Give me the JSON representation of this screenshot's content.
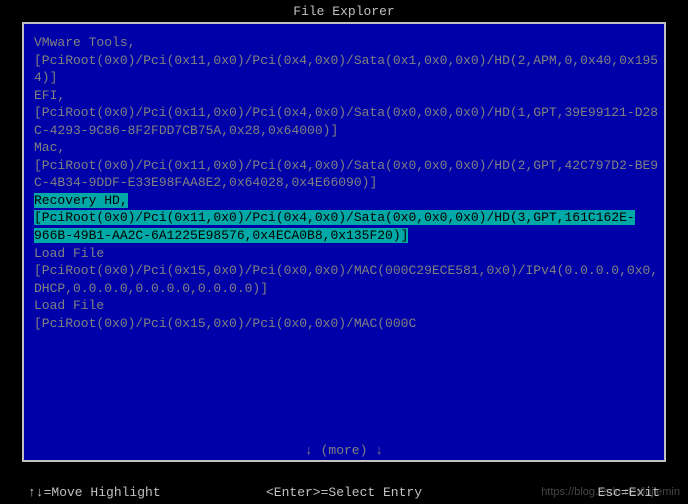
{
  "title": "File Explorer",
  "entries": [
    {
      "label": "VMware Tools,",
      "path": "[PciRoot(0x0)/Pci(0x11,0x0)/Pci(0x4,0x0)/Sata(0x1,0x0,0x0)/HD(2,APM,0,0x40,0x1954)]",
      "selected": false
    },
    {
      "label": "EFI,",
      "path": "[PciRoot(0x0)/Pci(0x11,0x0)/Pci(0x4,0x0)/Sata(0x0,0x0,0x0)/HD(1,GPT,39E99121-D28C-4293-9C86-8F2FDD7CB75A,0x28,0x64000)]",
      "selected": false
    },
    {
      "label": "Mac,",
      "path": "[PciRoot(0x0)/Pci(0x11,0x0)/Pci(0x4,0x0)/Sata(0x0,0x0,0x0)/HD(2,GPT,42C797D2-BE9C-4B34-9DDF-E33E98FAA8E2,0x64028,0x4E66090)]",
      "selected": false
    },
    {
      "label": "Recovery HD,",
      "path": "[PciRoot(0x0)/Pci(0x11,0x0)/Pci(0x4,0x0)/Sata(0x0,0x0,0x0)/HD(3,GPT,161C162E-966B-49B1-AA2C-6A1225E98576,0x4ECA0B8,0x135F20)]",
      "selected": true
    },
    {
      "label": "Load File",
      "path": "[PciRoot(0x0)/Pci(0x15,0x0)/Pci(0x0,0x0)/MAC(000C29ECE581,0x0)/IPv4(0.0.0.0,0x0,DHCP,0.0.0.0,0.0.0.0,0.0.0.0)]",
      "selected": false
    },
    {
      "label": "Load File",
      "path": "[PciRoot(0x0)/Pci(0x15,0x0)/Pci(0x0,0x0)/MAC(000C",
      "selected": false
    }
  ],
  "more": "↓ (more) ↓",
  "footer": {
    "left": "↑↓=Move Highlight",
    "center": "<Enter>=Select Entry",
    "right": "Esc=Exit"
  },
  "watermark": "https://blog.csdn.net/lujiemin"
}
